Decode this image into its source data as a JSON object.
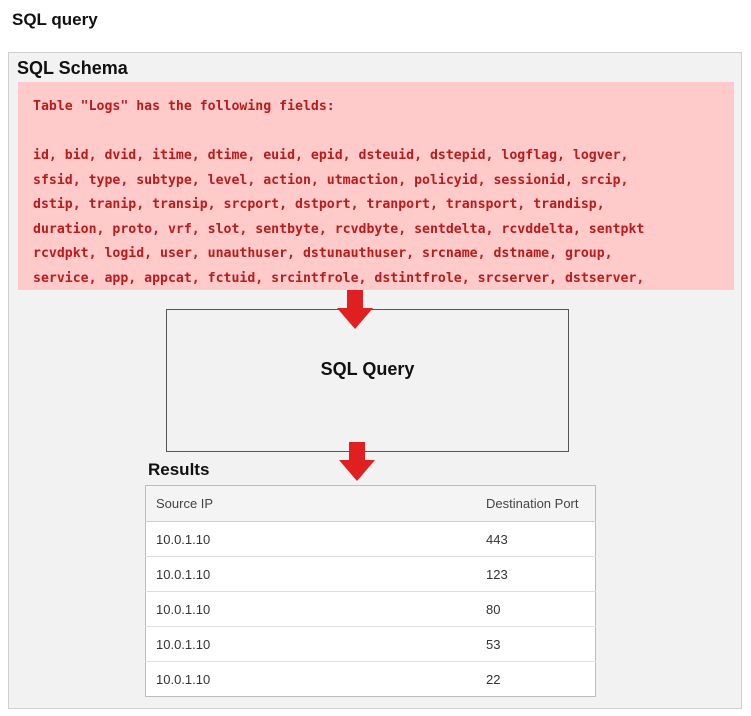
{
  "page_title": "SQL query",
  "schema": {
    "title": "SQL Schema",
    "intro": "Table \"Logs\" has the following fields:",
    "field_lines": [
      "id, bid, dvid, itime, dtime, euid, epid, dsteuid, dstepid, logflag, logver,",
      "sfsid, type, subtype, level, action, utmaction, policyid, sessionid, srcip,",
      "dstip, tranip, transip, srcport, dstport, tranport, transport, trandisp,",
      "duration, proto, vrf, slot, sentbyte, rcvdbyte, sentdelta, rcvddelta, sentpkt",
      "rcvdpkt, logid, user, unauthuser, dstunauthuser, srcname, dstname, group,",
      "service, app, appcat, fctuid, srcintfrole, dstintfrole, srcserver, dstserver,"
    ]
  },
  "query_box_label": "SQL Query",
  "results": {
    "title": "Results",
    "columns": [
      "Source IP",
      "Destination Port"
    ],
    "rows": [
      [
        "10.0.1.10",
        "443"
      ],
      [
        "10.0.1.10",
        "123"
      ],
      [
        "10.0.1.10",
        "80"
      ],
      [
        "10.0.1.10",
        "53"
      ],
      [
        "10.0.1.10",
        "22"
      ]
    ]
  },
  "colors": {
    "schema_bg": "#ffcaca",
    "schema_text": "#b81c1c",
    "arrow": "#e02020",
    "panel_bg": "#f2f2f2"
  }
}
